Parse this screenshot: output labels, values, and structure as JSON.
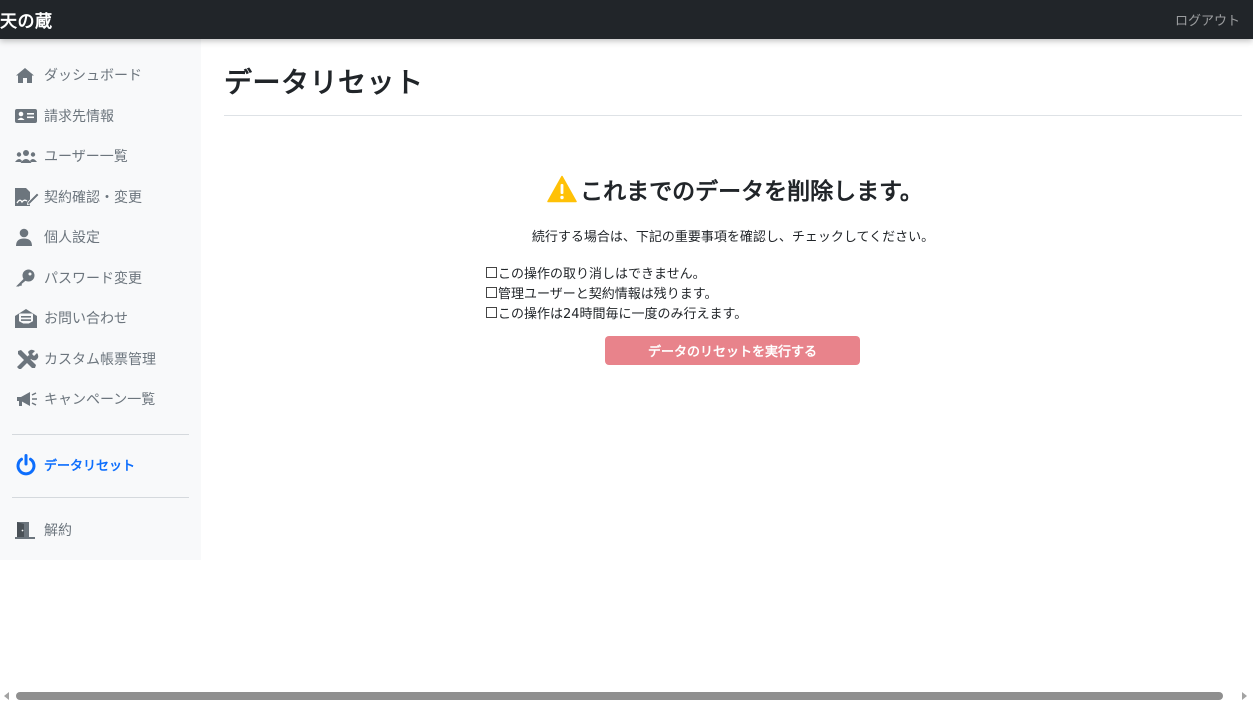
{
  "header": {
    "brand": "天の蔵",
    "logout_label": "ログアウト"
  },
  "sidebar": {
    "items": [
      {
        "label": "ダッシュボード",
        "icon": "home-icon"
      },
      {
        "label": "請求先情報",
        "icon": "id-card-icon"
      },
      {
        "label": "ユーザー一覧",
        "icon": "users-icon"
      },
      {
        "label": "契約確認・変更",
        "icon": "file-signature-icon"
      },
      {
        "label": "個人設定",
        "icon": "user-icon"
      },
      {
        "label": "パスワード変更",
        "icon": "key-icon"
      },
      {
        "label": "お問い合わせ",
        "icon": "envelope-open-icon"
      },
      {
        "label": "カスタム帳票管理",
        "icon": "tools-icon"
      },
      {
        "label": "キャンペーン一覧",
        "icon": "bullhorn-icon"
      }
    ],
    "active_item": {
      "label": "データリセット",
      "icon": "power-icon"
    },
    "footer_item": {
      "label": "解約",
      "icon": "door-open-icon"
    }
  },
  "main": {
    "title": "データリセット",
    "warning_heading": "これまでのデータを削除します。",
    "instruction": "続行する場合は、下記の重要事項を確認し、チェックしてください。",
    "checks": [
      {
        "label": "この操作の取り消しはできません。",
        "checked": false
      },
      {
        "label": "管理ユーザーと契約情報は残ります。",
        "checked": false
      },
      {
        "label": "この操作は24時間毎に一度のみ行えます。",
        "checked": false
      }
    ],
    "reset_button_label": "データのリセットを実行する"
  },
  "colors": {
    "navbar_bg": "#212529",
    "sidebar_bg": "#f8f9fa",
    "active_link": "#0d6efd",
    "warning_icon": "#ffc107",
    "button_disabled_danger": "#e8838b"
  }
}
